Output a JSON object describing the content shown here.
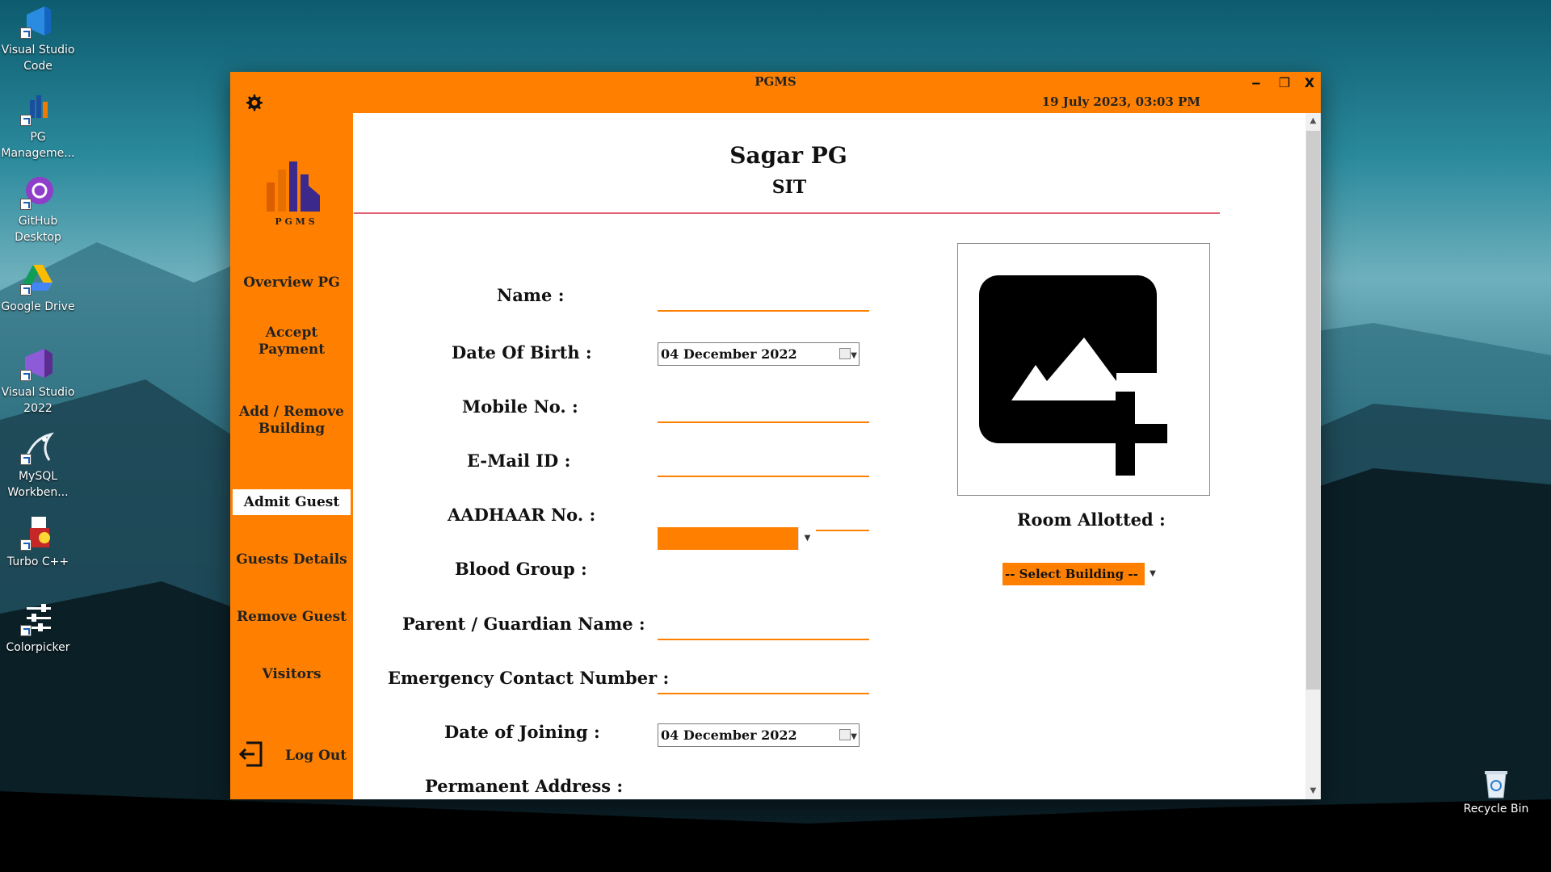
{
  "desktop": {
    "icons": [
      {
        "label": "Visual Studio Code"
      },
      {
        "label": "PG Manageme..."
      },
      {
        "label": "GitHub Desktop"
      },
      {
        "label": "Google Drive"
      },
      {
        "label": "Visual Studio 2022"
      },
      {
        "label": "MySQL Workben..."
      },
      {
        "label": "Turbo C++"
      },
      {
        "label": "Colorpicker"
      }
    ],
    "recycle_bin": "Recycle Bin"
  },
  "window": {
    "title": "PGMS",
    "datetime": "19 July 2023,  03:03 PM",
    "controls": {
      "minimize": "‒",
      "maximize": "❐",
      "close": "X"
    },
    "accent": "#ff8000"
  },
  "sidebar": {
    "logo_text": "P G M S",
    "items": [
      {
        "label": "Overview PG"
      },
      {
        "label": "Accept\nPayment"
      },
      {
        "label": "Add / Remove\nBuilding"
      },
      {
        "label": "Admit Guest"
      },
      {
        "label": "Guests Details"
      },
      {
        "label": "Remove Guest"
      },
      {
        "label": "Visitors"
      }
    ],
    "logout": "Log Out"
  },
  "header": {
    "org_name": "Sagar PG",
    "org_sub": "SIT"
  },
  "form": {
    "name_label": "Name :",
    "dob_label": "Date Of Birth :",
    "dob_value": "04  December  2022",
    "mobile_label": "Mobile No. :",
    "email_label": "E-Mail ID :",
    "aadhaar_label": "AADHAAR No. :",
    "blood_label": "Blood Group :",
    "parent_label": "Parent / Guardian Name :",
    "emergency_label": "Emergency Contact Number :",
    "doj_label": "Date of Joining :",
    "doj_value": "04  December  2022",
    "address_label": "Permanent Address :"
  },
  "photo": {
    "icon": "add-photo-icon"
  },
  "room": {
    "label": "Room Allotted :",
    "building_select": "-- Select Building --"
  }
}
